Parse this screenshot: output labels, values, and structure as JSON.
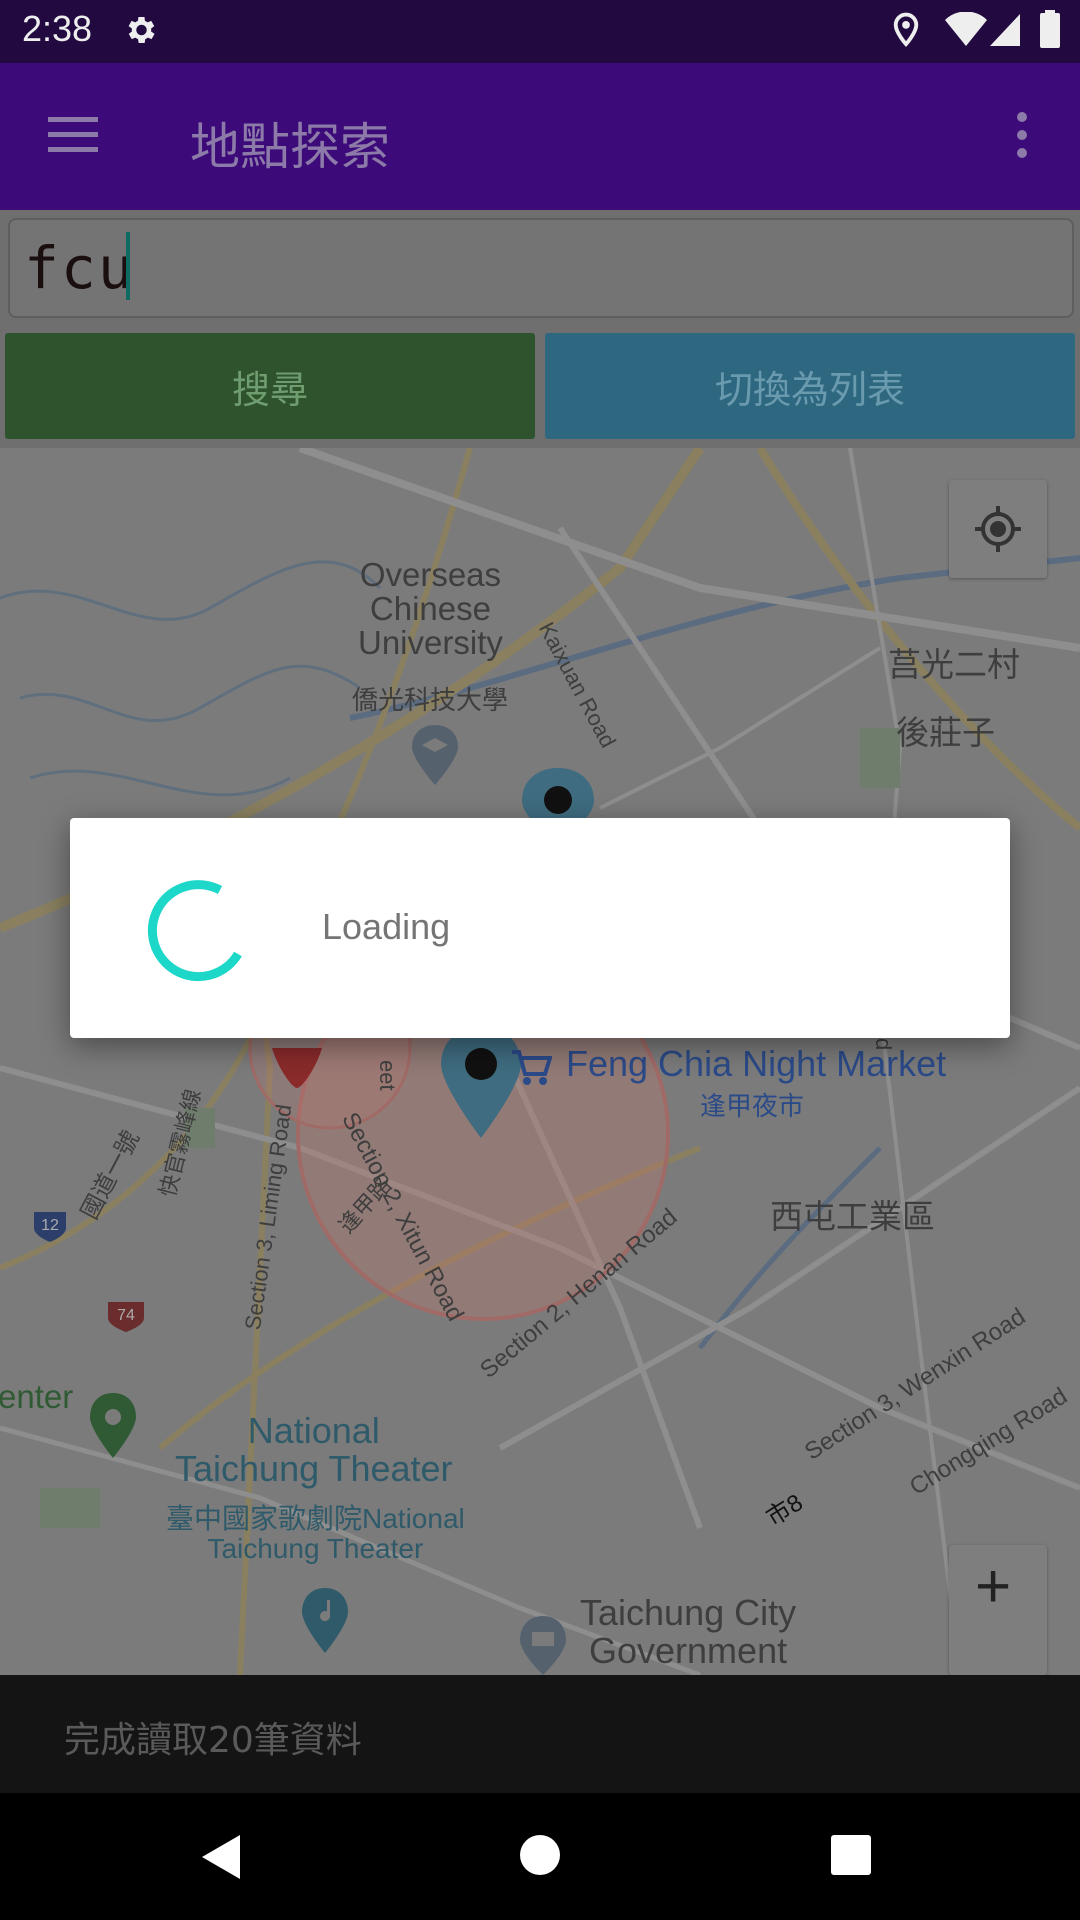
{
  "status_bar": {
    "time": "2:38",
    "icons": [
      "settings-icon",
      "location-icon",
      "wifi-icon",
      "signal-icon",
      "battery-icon"
    ]
  },
  "app_bar": {
    "title": "地點探索",
    "menu_icon": "hamburger-menu-icon",
    "overflow_icon": "more-vert-icon"
  },
  "search": {
    "value": "fcu"
  },
  "buttons": {
    "search_label": "搜尋",
    "toggle_list_label": "切換為列表"
  },
  "map": {
    "labels": {
      "overseas": "Overseas\nChinese\nUniversity",
      "overseas_zh": "僑光科技大學",
      "kaixuan": "Kaixuan Road",
      "juguang": "莒光二村",
      "houzhuangzi": "後莊子",
      "fengchia": "Feng Chia Night Market",
      "fengchia_zh": "逢甲夜市",
      "xitun_industrial": "西屯工業區",
      "section3_liming": "Section 3, Liming Road",
      "guodao": "國道一號",
      "kuaiguan": "快官霧峰線",
      "section2_xitun": "Section 2, Xitun Road",
      "fengjia_road": "逢甲路",
      "section2_henan": "Section 2, Henan Road",
      "section3_wenxin": "Section 3, Wenxin Road",
      "chongqing": "Chongqing Road",
      "shi8": "市8",
      "enter": "enter",
      "national_theater": "National\nTaichung Theater",
      "national_theater_zh": "臺中國家歌劇院National\nTaichung Theater",
      "city_gov": "Taichung City\nGovernment",
      "street_partial": "eet",
      "road_partial": "d",
      "shield_12": "12",
      "shield_74": "74"
    },
    "controls": {
      "my_location_icon": "my-location-icon",
      "zoom_in_label": "+"
    }
  },
  "dialog": {
    "message": "Loading"
  },
  "snackbar": {
    "text": "完成讀取20筆資料"
  },
  "nav_bar": {
    "back_icon": "back-triangle-icon",
    "home_icon": "home-circle-icon",
    "recents_icon": "recents-square-icon"
  },
  "colors": {
    "app_bar": "#3d0a7a",
    "status_bar": "#220a40",
    "search_button": "#2e532d",
    "list_button": "#2e6780",
    "spinner": "#1dd8c8"
  }
}
